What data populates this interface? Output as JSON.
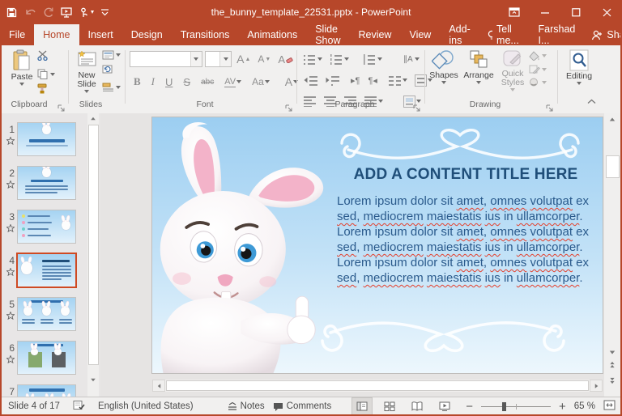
{
  "colors": {
    "accent": "#b7472a",
    "selection": "#cf4a23",
    "slide_title_text": "#1f4e79",
    "slide_body_text": "#2a5a8c",
    "slide_gradient_top": "#9ccef1",
    "slide_gradient_bottom": "#edf7fd"
  },
  "titlebar": {
    "title": "the_bunny_template_22531.pptx - PowerPoint",
    "qat_icons": [
      "save-icon",
      "undo-icon",
      "redo-icon",
      "start-slideshow-icon",
      "touch-mode-icon",
      "customize-qat-icon"
    ],
    "window_control_icons": [
      "ribbon-display-options-icon",
      "minimize-icon",
      "maximize-icon",
      "close-icon"
    ]
  },
  "ribbon_tabs": {
    "items": [
      {
        "label": "File",
        "active": false
      },
      {
        "label": "Home",
        "active": true
      },
      {
        "label": "Insert",
        "active": false
      },
      {
        "label": "Design",
        "active": false
      },
      {
        "label": "Transitions",
        "active": false
      },
      {
        "label": "Animations",
        "active": false
      },
      {
        "label": "Slide Show",
        "active": false
      },
      {
        "label": "Review",
        "active": false
      },
      {
        "label": "View",
        "active": false
      },
      {
        "label": "Add-ins",
        "active": false
      }
    ],
    "tell_me": "Tell me...",
    "account": "Farshad I...",
    "share": "Share"
  },
  "ribbon": {
    "clipboard": {
      "label": "Clipboard",
      "paste": "Paste",
      "icons": [
        "paste-icon",
        "cut-icon",
        "copy-icon",
        "format-painter-icon"
      ]
    },
    "slides": {
      "label": "Slides",
      "new_slide": "New Slide",
      "icons": [
        "new-slide-icon",
        "layout-icon",
        "reset-icon",
        "section-icon"
      ]
    },
    "font": {
      "label": "Font",
      "font_name_value": "",
      "font_size_value": "",
      "bold": "B",
      "italic": "I",
      "underline": "U",
      "strike": "S",
      "abc": "abc",
      "char_spacing": "AV",
      "change_case": "Aa",
      "font_color": "A"
    },
    "paragraph": {
      "label": "Paragraph"
    },
    "drawing": {
      "label": "Drawing",
      "shapes": "Shapes",
      "arrange": "Arrange",
      "quick_styles": "Quick Styles"
    },
    "editing": {
      "label": "Editing"
    }
  },
  "thumbnails": {
    "selected": 4,
    "items": [
      {
        "num": "1",
        "starred": true,
        "kind": "title"
      },
      {
        "num": "2",
        "starred": true,
        "kind": "headertext"
      },
      {
        "num": "3",
        "starred": true,
        "kind": "bullets"
      },
      {
        "num": "4",
        "starred": true,
        "kind": "contentleft"
      },
      {
        "num": "5",
        "starred": true,
        "kind": "threecol"
      },
      {
        "num": "6",
        "starred": true,
        "kind": "twoimg"
      },
      {
        "num": "7",
        "starred": false,
        "kind": "header7"
      }
    ]
  },
  "slide": {
    "title": "ADD A CONTENT TITLE HERE",
    "body": "Lorem ipsum dolor sit amet, omnes volutpat ex sed, mediocrem maiestatis ius in ullamcorper. Lorem ipsum dolor sit amet, omnes volutpat ex sed, mediocrem maiestatis ius in ullamcorper. Lorem ipsum dolor sit amet, omnes volutpat ex sed, mediocrem maiestatis ius in ullamcorper.",
    "misspelled": [
      "amet",
      "omnes",
      "volutpat",
      "sed",
      "mediocrem",
      "maiestatis",
      "ius",
      "ullamcorper"
    ],
    "graphics": [
      "bunny-illustration",
      "swirl-ornament-top",
      "swirl-ornament-bottom"
    ]
  },
  "statusbar": {
    "slide_counter": "Slide 4 of 17",
    "language": "English (United States)",
    "notes_label": "Notes",
    "comments_label": "Comments",
    "zoom_label": "65 %",
    "view_icons": [
      "normal-view-icon",
      "slide-sorter-icon",
      "reading-view-icon",
      "slide-show-icon",
      "fit-to-window-icon"
    ]
  }
}
